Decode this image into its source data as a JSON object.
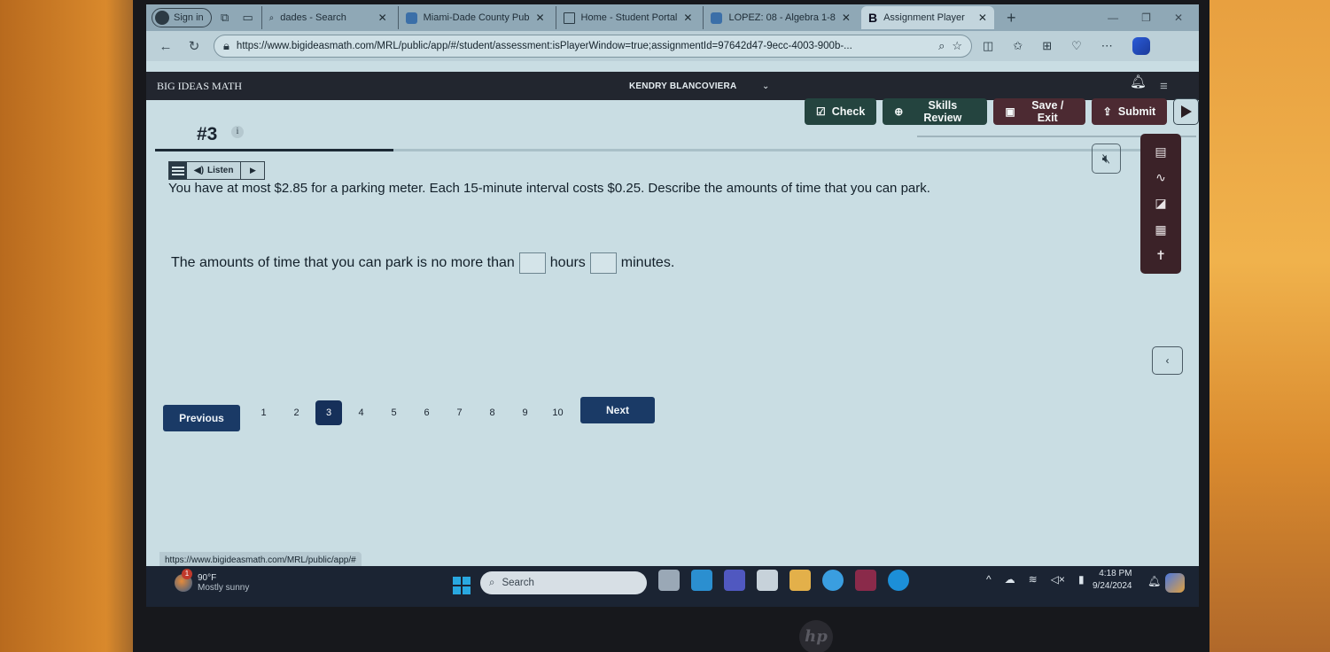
{
  "browser": {
    "sign_in_label": "Sign in",
    "tabs": [
      {
        "title": "dades - Search",
        "icon": "search-icon"
      },
      {
        "title": "Miami-Dade County Pub",
        "icon": "site-favicon"
      },
      {
        "title": "Home - Student Portal",
        "icon": "document-icon"
      },
      {
        "title": "LOPEZ: 08 - Algebra 1-8",
        "icon": "site-favicon"
      },
      {
        "title": "Assignment Player",
        "icon": "b-logo-icon",
        "active": true
      }
    ],
    "url": "https://www.bigideasmath.com/MRL/public/app/#/student/assessment:isPlayerWindow=true;assignmentId=97642d47-9ecc-4003-900b-...",
    "status_url": "https://www.bigideasmath.com/MRL/public/app/#"
  },
  "app": {
    "brand": "BIG IDEAS MATH",
    "user_name": "KENDRY BLANCOVIERA",
    "question_number": "#3",
    "info_label": "i",
    "buttons": {
      "check": "Check",
      "skills_review": "Skills Review",
      "save_exit": "Save / Exit",
      "submit": "Submit"
    },
    "listen_label": "Listen",
    "progress_fraction": 0.24,
    "question_text": "You have at most $2.85 for a parking meter. Each 15-minute interval costs $0.25. Describe the amounts of time that you can park.",
    "answer": {
      "prefix": "The amounts of time that you can park is no more than",
      "box1_value": "",
      "middle": "hours",
      "box2_value": "",
      "suffix": "minutes."
    },
    "tools": [
      "calculator-icon",
      "scribble-icon",
      "graph-icon",
      "calendar-icon",
      "accessibility-icon"
    ],
    "pagination": {
      "previous_label": "Previous",
      "next_label": "Next",
      "pages": [
        "1",
        "2",
        "3",
        "4",
        "5",
        "6",
        "7",
        "8",
        "9",
        "10"
      ],
      "current": "3"
    }
  },
  "taskbar": {
    "weather_badge": "1",
    "temperature": "90°F",
    "condition": "Mostly sunny",
    "search_placeholder": "Search",
    "time": "4:18 PM",
    "date": "9/24/2024"
  }
}
